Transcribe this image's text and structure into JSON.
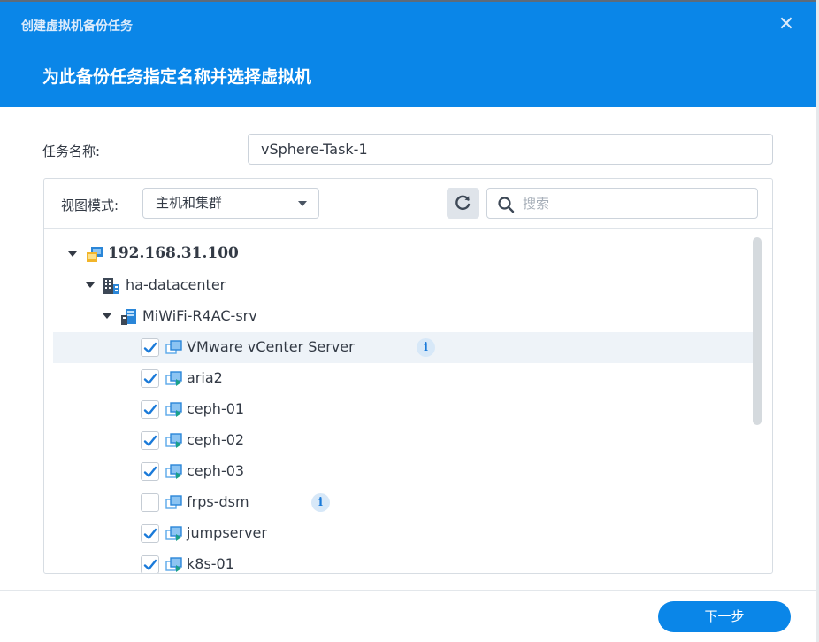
{
  "window": {
    "title": "创建虚拟机备份任务",
    "subtitle": "为此备份任务指定名称并选择虚拟机",
    "close_glyph": "✕"
  },
  "form": {
    "task_name_label": "任务名称:",
    "task_name_value": "vSphere-Task-1"
  },
  "toolbar": {
    "view_mode_label": "视图模式:",
    "view_mode_value": "主机和集群",
    "search_placeholder": "搜索"
  },
  "tree": {
    "host": {
      "label": "192.168.31.100",
      "icon": "host-icon"
    },
    "datacenter": {
      "label": "ha-datacenter",
      "icon": "datacenter-icon"
    },
    "server": {
      "label": "MiWiFi-R4AC-srv",
      "icon": "server-icon"
    },
    "vms": [
      {
        "label": "VMware vCenter Server",
        "checked": true,
        "info": true
      },
      {
        "label": "aria2",
        "checked": true,
        "info": false
      },
      {
        "label": "ceph-01",
        "checked": true,
        "info": false
      },
      {
        "label": "ceph-02",
        "checked": true,
        "info": false
      },
      {
        "label": "ceph-03",
        "checked": true,
        "info": false
      },
      {
        "label": "frps-dsm",
        "checked": false,
        "info": true
      },
      {
        "label": "jumpserver",
        "checked": true,
        "info": false
      },
      {
        "label": "k8s-01",
        "checked": true,
        "info": false
      }
    ],
    "info_glyph": "i"
  },
  "footer": {
    "next_label": "下一步"
  },
  "colors": {
    "accent": "#0a86e8",
    "check": "#1a7ad9"
  }
}
